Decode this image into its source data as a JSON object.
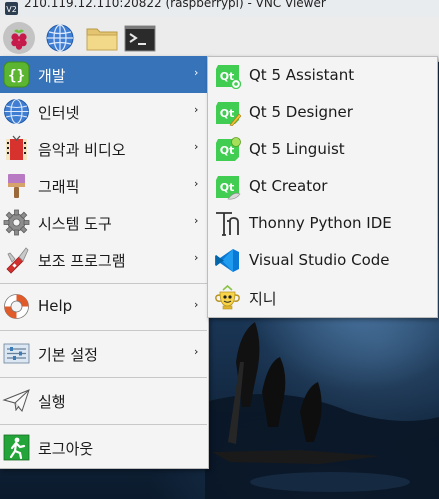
{
  "window": {
    "title": "210.119.12.110:20822 (raspberrypi) - VNC Viewer"
  },
  "panel": {
    "buttons": [
      {
        "name": "raspberry-menu",
        "icon": "raspberry-icon"
      },
      {
        "name": "web-browser",
        "icon": "globe-icon"
      },
      {
        "name": "file-manager",
        "icon": "folder-icon"
      },
      {
        "name": "terminal",
        "icon": "terminal-icon"
      }
    ]
  },
  "menu": {
    "items": [
      {
        "label": "개발",
        "icon": "braces-icon",
        "has_submenu": true,
        "active": true
      },
      {
        "label": "인터넷",
        "icon": "globe-icon",
        "has_submenu": true
      },
      {
        "label": "음악과 비디오",
        "icon": "media-icon",
        "has_submenu": true
      },
      {
        "label": "그래픽",
        "icon": "paintbrush-icon",
        "has_submenu": true
      },
      {
        "label": "시스템 도구",
        "icon": "gear-icon",
        "has_submenu": true
      },
      {
        "label": "보조 프로그램",
        "icon": "swiss-knife-icon",
        "has_submenu": true
      },
      {
        "label": "Help",
        "icon": "lifebuoy-icon",
        "has_submenu": true
      },
      {
        "label": "기본 설정",
        "icon": "preferences-icon",
        "has_submenu": true
      },
      {
        "label": "실행",
        "icon": "paper-plane-icon",
        "has_submenu": false
      },
      {
        "label": "로그아웃",
        "icon": "exit-icon",
        "has_submenu": false
      }
    ],
    "arrow": "›"
  },
  "submenu": {
    "items": [
      {
        "label": "Qt 5 Assistant",
        "icon": "qt-assistant-icon"
      },
      {
        "label": "Qt 5 Designer",
        "icon": "qt-designer-icon"
      },
      {
        "label": "Qt 5 Linguist",
        "icon": "qt-linguist-icon"
      },
      {
        "label": "Qt Creator",
        "icon": "qt-creator-icon"
      },
      {
        "label": "Thonny Python IDE",
        "icon": "thonny-icon"
      },
      {
        "label": "Visual Studio Code",
        "icon": "vscode-icon"
      },
      {
        "label": "지니",
        "icon": "geany-icon"
      }
    ],
    "qt_badge": "Qt"
  },
  "colors": {
    "highlight": "#3673b9",
    "qt_green": "#41cd52",
    "vscode_blue": "#0a78d4"
  }
}
